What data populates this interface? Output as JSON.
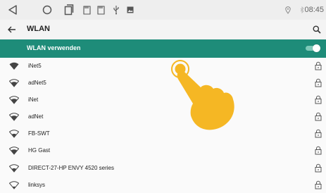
{
  "statusbar": {
    "time": "08:45",
    "icons": [
      "back-triangle-icon",
      "home-circle-icon",
      "recent-apps-icon",
      "sd-card-icon",
      "sd-card-icon",
      "usb-icon",
      "image-icon",
      "location-icon",
      "bluetooth-icon"
    ]
  },
  "appbar": {
    "title": "WLAN",
    "back_icon": "arrow-left-icon",
    "search_icon": "search-icon"
  },
  "wifi_toggle": {
    "label": "WLAN verwenden",
    "enabled": true
  },
  "networks": [
    {
      "ssid": "iNet5",
      "signal": "full",
      "secured": true
    },
    {
      "ssid": "adNet5",
      "signal": "strong",
      "secured": true
    },
    {
      "ssid": "iNet",
      "signal": "strong",
      "secured": true
    },
    {
      "ssid": "adNet",
      "signal": "strong",
      "secured": true
    },
    {
      "ssid": "FB-SWT",
      "signal": "medium",
      "secured": true
    },
    {
      "ssid": "HG Gast",
      "signal": "strong",
      "secured": true
    },
    {
      "ssid": "DIRECT-27-HP ENVY 4520 series",
      "signal": "medium",
      "secured": true
    },
    {
      "ssid": "linksys",
      "signal": "weak",
      "secured": true
    }
  ],
  "colors": {
    "accent": "#1e8c79",
    "hand": "#f5b724",
    "statusbar": "#eeeeee"
  }
}
